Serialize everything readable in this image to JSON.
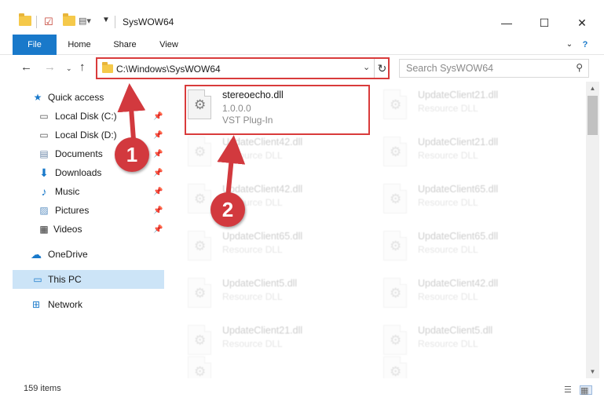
{
  "window": {
    "title": "SysWOW64",
    "minimize": "—",
    "maximize": "☐",
    "close": "✕"
  },
  "ribbon": {
    "tabs": [
      "File",
      "Home",
      "Share",
      "View"
    ],
    "expand_icon": "chevron-down-icon",
    "help": "?"
  },
  "address": {
    "path": "C:\\Windows\\SysWOW64",
    "search_placeholder": "Search SysWOW64"
  },
  "sidebar": {
    "items": [
      {
        "label": "Quick access",
        "icon": "star-icon",
        "pinned": false
      },
      {
        "label": "Local Disk (C:)",
        "icon": "drive-icon",
        "pinned": true
      },
      {
        "label": "Local Disk (D:)",
        "icon": "drive-icon",
        "pinned": true
      },
      {
        "label": "Documents",
        "icon": "documents-icon",
        "pinned": true
      },
      {
        "label": "Downloads",
        "icon": "download-icon",
        "pinned": true
      },
      {
        "label": "Music",
        "icon": "music-icon",
        "pinned": true
      },
      {
        "label": "Pictures",
        "icon": "pictures-icon",
        "pinned": true
      },
      {
        "label": "Videos",
        "icon": "videos-icon",
        "pinned": true
      },
      {
        "label": "OneDrive",
        "icon": "cloud-icon",
        "pinned": false
      },
      {
        "label": "This PC",
        "icon": "computer-icon",
        "pinned": false,
        "selected": true
      },
      {
        "label": "Network",
        "icon": "network-icon",
        "pinned": false
      }
    ]
  },
  "files": {
    "highlighted": {
      "name": "stereoecho.dll",
      "version": "1.0.0.0",
      "description": "VST Plug-In"
    },
    "left_column": [
      {
        "name": "UpdateClient42.dll",
        "description": "Resource DLL"
      },
      {
        "name": "UpdateClient42.dll",
        "description": "Resource DLL"
      },
      {
        "name": "UpdateClient65.dll",
        "description": "Resource DLL"
      },
      {
        "name": "UpdateClient5.dll",
        "description": "Resource DLL"
      },
      {
        "name": "UpdateClient21.dll",
        "description": "Resource DLL"
      },
      {
        "name": "",
        "description": ""
      }
    ],
    "right_column": [
      {
        "name": "UpdateClient21.dll",
        "description": "Resource DLL"
      },
      {
        "name": "UpdateClient21.dll",
        "description": "Resource DLL"
      },
      {
        "name": "UpdateClient65.dll",
        "description": "Resource DLL"
      },
      {
        "name": "UpdateClient65.dll",
        "description": "Resource DLL"
      },
      {
        "name": "UpdateClient42.dll",
        "description": "Resource DLL"
      },
      {
        "name": "UpdateClient5.dll",
        "description": "Resource DLL"
      },
      {
        "name": "",
        "description": ""
      }
    ]
  },
  "status": {
    "item_count": "159 items"
  },
  "callouts": [
    "1",
    "2"
  ],
  "colors": {
    "accent": "#1979ca",
    "highlight_red": "#d93b3b",
    "selected_bg": "#cce4f7"
  }
}
